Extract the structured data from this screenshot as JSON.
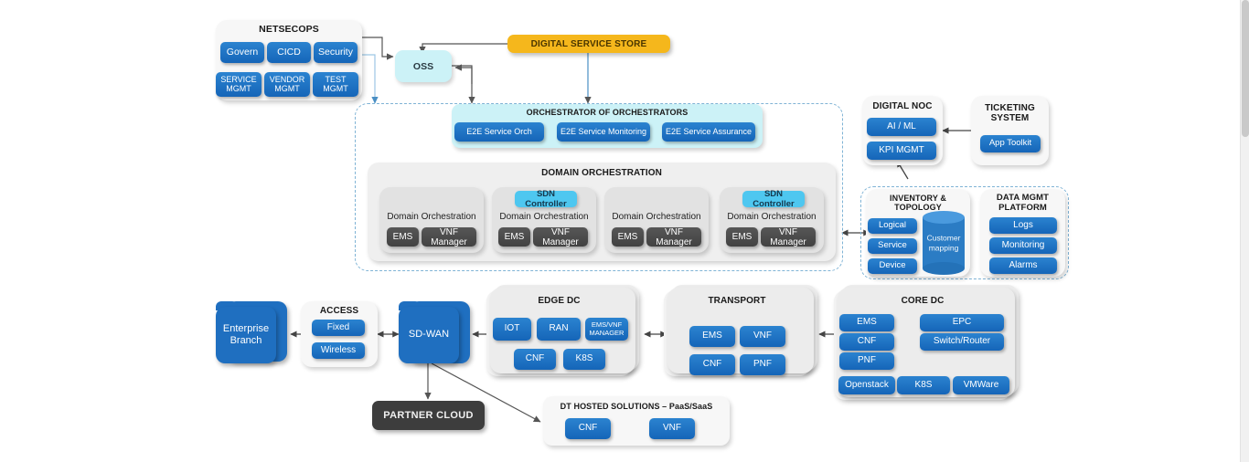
{
  "netsecops": {
    "title": "NETSECOPS",
    "row1": [
      "Govern",
      "CICD",
      "Security"
    ],
    "row2": [
      "SERVICE\nMGMT",
      "VENDOR\nMGMT",
      "TEST\nMGMT"
    ]
  },
  "oss": {
    "label": "OSS"
  },
  "digital_service_store": {
    "label": "DIGITAL SERVICE STORE",
    "color": "#f5b71c"
  },
  "orchestrator": {
    "title": "ORCHESTRATOR OF ORCHESTRATORS",
    "items": [
      "E2E Service Orch",
      "E2E Service Monitoring",
      "E2E Service Assurance"
    ]
  },
  "domain_orchestration": {
    "title": "DOMAIN ORCHESTRATION",
    "columns": [
      {
        "sdn": null,
        "label": "Domain Orchestration",
        "sub": [
          "EMS",
          "VNF Manager"
        ]
      },
      {
        "sdn": "SDN Controller",
        "label": "Domain Orchestration",
        "sub": [
          "EMS",
          "VNF Manager"
        ]
      },
      {
        "sdn": null,
        "label": "Domain Orchestration",
        "sub": [
          "EMS",
          "VNF Manager"
        ]
      },
      {
        "sdn": "SDN Controller",
        "label": "Domain Orchestration",
        "sub": [
          "EMS",
          "VNF Manager"
        ]
      }
    ]
  },
  "digital_noc": {
    "title": "DIGITAL NOC",
    "items": [
      "AI / ML",
      "KPI MGMT"
    ]
  },
  "ticketing": {
    "title_line1": "TICKETING",
    "title_line2": "SYSTEM",
    "items": [
      "App Toolkit"
    ]
  },
  "inventory": {
    "title_line1": "INVENTORY &",
    "title_line2": "TOPOLOGY",
    "items": [
      "Logical",
      "Service",
      "Device"
    ],
    "cylinder": "Customer\nmapping"
  },
  "data_mgmt": {
    "title_line1": "DATA MGMT",
    "title_line2": "PLATFORM",
    "items": [
      "Logs",
      "Monitoring",
      "Alarms"
    ]
  },
  "enterprise_branch": {
    "label": "Enterprise\nBranch"
  },
  "access": {
    "title": "ACCESS",
    "items": [
      "Fixed",
      "Wireless"
    ]
  },
  "sdwan": {
    "label": "SD-WAN"
  },
  "edge_dc": {
    "title": "EDGE DC",
    "row1": [
      "IOT",
      "RAN",
      "EMS/VNF\nMANAGER"
    ],
    "row2": [
      "CNF",
      "K8S"
    ]
  },
  "transport": {
    "title": "TRANSPORT",
    "row1": [
      "EMS",
      "VNF"
    ],
    "row2": [
      "CNF",
      "PNF"
    ]
  },
  "core_dc": {
    "title": "CORE DC",
    "left": [
      "EMS",
      "CNF",
      "PNF"
    ],
    "right": [
      "EPC",
      "Switch/Router"
    ],
    "bottom": [
      "Openstack",
      "K8S",
      "VMWare"
    ]
  },
  "partner_cloud": {
    "label": "PARTNER CLOUD"
  },
  "dt_hosted": {
    "title": "DT HOSTED SOLUTIONS – PaaS/SaaS",
    "items": [
      "CNF",
      "VNF"
    ]
  },
  "colors": {
    "blue": "#1f6fc0",
    "cyan": "#ccf2f7",
    "amber": "#f5b71c",
    "sdn": "#4ec7f0",
    "dark": "#3d3d3d",
    "panel": "#f2f2f2",
    "dashed_border": "#7fb3d5"
  }
}
